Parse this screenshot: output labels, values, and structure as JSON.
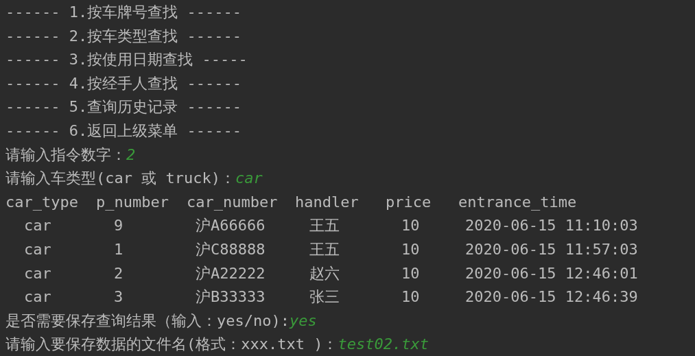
{
  "console": [
    {
      "kind": "text",
      "text": "------ 1.按车牌号查找 ------"
    },
    {
      "kind": "text",
      "text": "------ 2.按车类型查找 ------"
    },
    {
      "kind": "text",
      "text": "------ 3.按使用日期查找 -----"
    },
    {
      "kind": "text",
      "text": "------ 4.按经手人查找 ------"
    },
    {
      "kind": "text",
      "text": "------ 5.查询历史记录 ------"
    },
    {
      "kind": "text",
      "text": "------ 6.返回上级菜单 ------"
    },
    {
      "kind": "prompt",
      "text": "请输入指令数字：",
      "input": "2"
    },
    {
      "kind": "prompt",
      "text": "请输入车类型(car 或 truck)：",
      "input": "car"
    },
    {
      "kind": "table",
      "columns": [
        "car_type",
        "p_number",
        "car_number",
        "handler",
        "price",
        "entrance_time"
      ],
      "rows": [
        [
          "car",
          "9",
          "沪A66666",
          "王五",
          "10",
          "2020-06-15 11:10:03"
        ],
        [
          "car",
          "1",
          "沪C88888",
          "王五",
          "10",
          "2020-06-15 11:57:03"
        ],
        [
          "car",
          "2",
          "沪A22222",
          "赵六",
          "10",
          "2020-06-15 12:46:01"
        ],
        [
          "car",
          "3",
          "沪B33333",
          "张三",
          "10",
          "2020-06-15 12:46:39"
        ]
      ]
    },
    {
      "kind": "prompt",
      "text": "是否需要保存查询结果（输入：yes/no):",
      "input": "yes"
    },
    {
      "kind": "prompt",
      "text": "请输入要保存数据的文件名(格式：xxx.txt )：",
      "input": "test02.txt"
    }
  ]
}
